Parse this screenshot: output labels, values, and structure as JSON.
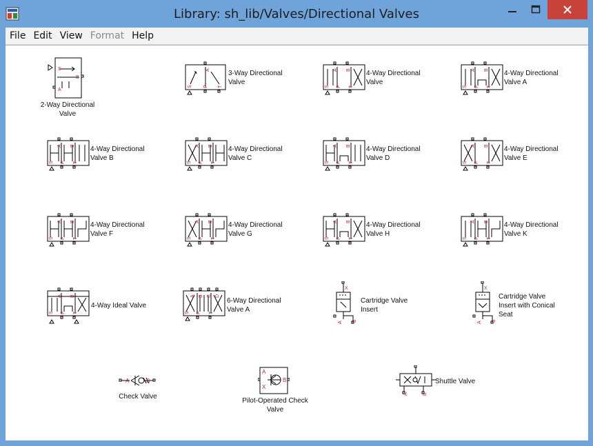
{
  "window": {
    "title": "Library: sh_lib/Valves/Directional Valves",
    "icon": "simulink-library-icon",
    "controls": [
      "minimize-icon",
      "maximize-icon",
      "close-icon"
    ],
    "colors": {
      "frame": "#6fa4db",
      "close": "#c7423a",
      "port_label": "#c0262c"
    }
  },
  "menu": {
    "items": [
      {
        "label": "File",
        "enabled": true
      },
      {
        "label": "Edit",
        "enabled": true
      },
      {
        "label": "View",
        "enabled": true
      },
      {
        "label": "Format",
        "enabled": false
      },
      {
        "label": "Help",
        "enabled": true
      }
    ]
  },
  "blocks": [
    {
      "name": "2-Way Directional Valve",
      "label": "2-Way Directional\nValve",
      "ports": [
        "S",
        "A",
        "B"
      ]
    },
    {
      "name": "3-Way Directional Valve",
      "label": "3-Way Directional\nValve",
      "ports": [
        "S",
        "A",
        "P",
        "T"
      ]
    },
    {
      "name": "4-Way Directional Valve",
      "label": "4-Way Directional\nValve",
      "ports": [
        "S",
        "A",
        "B",
        "P",
        "T"
      ]
    },
    {
      "name": "4-Way Directional Valve A",
      "label": "4-Way Directional\nValve A",
      "ports": [
        "S",
        "A",
        "B",
        "P",
        "T"
      ]
    },
    {
      "name": "4-Way Directional Valve B",
      "label": "4-Way Directional\nValve B",
      "ports": [
        "S",
        "A",
        "B",
        "P",
        "T"
      ]
    },
    {
      "name": "4-Way Directional Valve C",
      "label": "4-Way Directional\nValve C",
      "ports": [
        "S",
        "A",
        "B",
        "P",
        "T"
      ]
    },
    {
      "name": "4-Way Directional Valve D",
      "label": "4-Way Directional\nValve D",
      "ports": [
        "S",
        "A",
        "B",
        "P",
        "T"
      ]
    },
    {
      "name": "4-Way Directional Valve E",
      "label": "4-Way Directional\nValve E",
      "ports": [
        "S",
        "A",
        "B",
        "P",
        "T"
      ]
    },
    {
      "name": "4-Way Directional Valve F",
      "label": "4-Way Directional\nValve F",
      "ports": [
        "S",
        "A",
        "B",
        "P",
        "T"
      ]
    },
    {
      "name": "4-Way Directional Valve G",
      "label": "4-Way Directional\nValve G",
      "ports": [
        "S",
        "A",
        "B",
        "P",
        "T"
      ]
    },
    {
      "name": "4-Way Directional Valve H",
      "label": "4-Way Directional\nValve H",
      "ports": [
        "S",
        "A",
        "B",
        "P",
        "T"
      ]
    },
    {
      "name": "4-Way Directional Valve K",
      "label": "4-Way Directional\nValve K",
      "ports": [
        "S",
        "A",
        "B",
        "P",
        "T"
      ]
    },
    {
      "name": "4-Way Ideal Valve",
      "label": "4-Way Ideal Valve",
      "ports": [
        "S",
        "A",
        "B",
        "P",
        "T"
      ]
    },
    {
      "name": "6-Way Directional Valve A",
      "label": "6-Way Directional\nValve A",
      "ports": [
        "S",
        "A",
        "B",
        "C",
        "D",
        "P",
        "T"
      ]
    },
    {
      "name": "Cartridge Valve Insert",
      "label": "Cartridge Valve\nInsert",
      "ports": [
        "X",
        "A",
        "B"
      ]
    },
    {
      "name": "Cartridge Valve Insert with Conical Seat",
      "label": "Cartridge Valve\nInsert with Conical\nSeat",
      "ports": [
        "X",
        "A",
        "B"
      ]
    },
    {
      "name": "Check Valve",
      "label": "Check Valve",
      "ports": [
        "A",
        "B"
      ]
    },
    {
      "name": "Pilot-Operated Check Valve",
      "label": "Pilot-Operated Check\nValve",
      "ports": [
        "A",
        "B",
        "X"
      ]
    },
    {
      "name": "Shuttle Valve",
      "label": "Shuttle Valve",
      "ports": [
        "A",
        "B"
      ]
    }
  ]
}
